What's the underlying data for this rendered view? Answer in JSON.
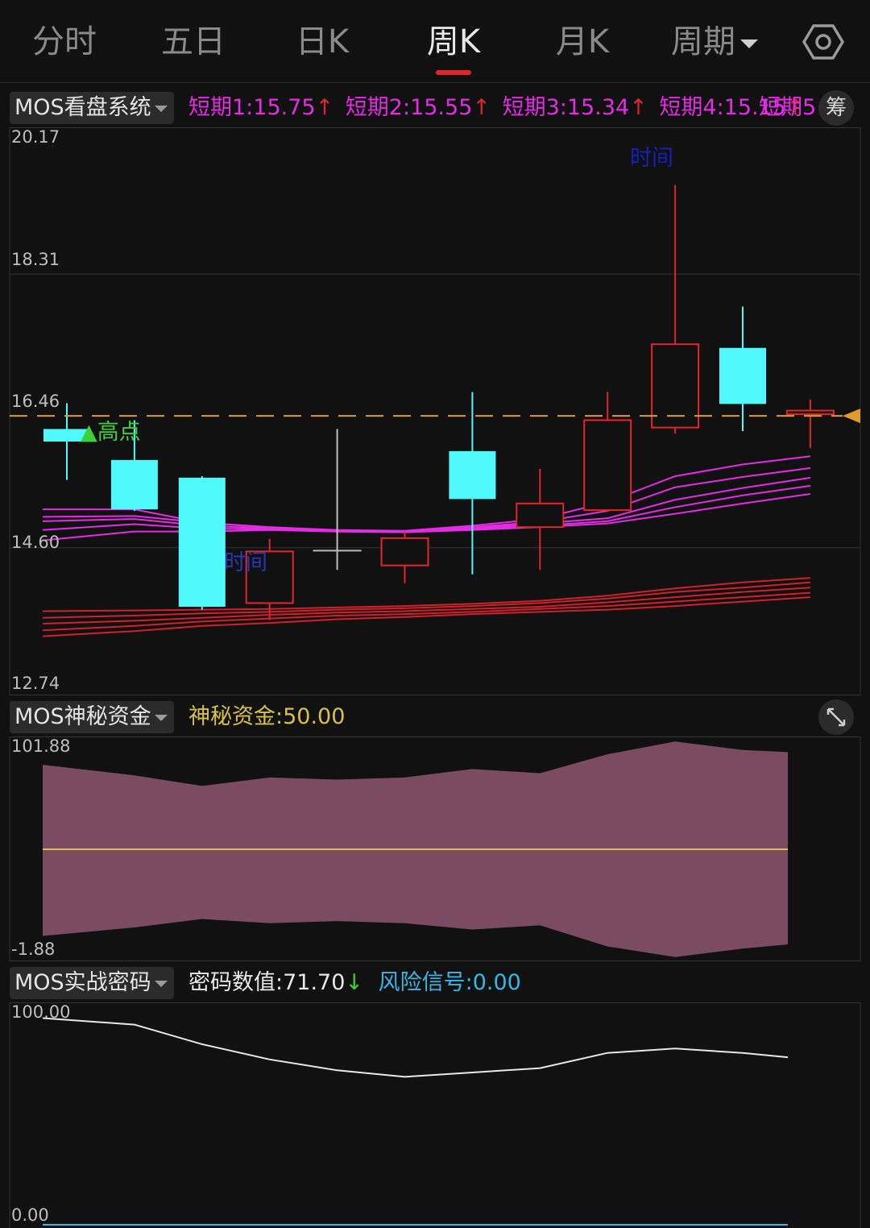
{
  "tabs": [
    "分时",
    "五日",
    "日K",
    "周K",
    "月K"
  ],
  "period_label": "周期",
  "colors": {
    "up": "#e0262a",
    "down": "#4ff9fb",
    "ma_short": "#e32ce4",
    "ma_long": "#d0202a",
    "price_line": "#e19a2c",
    "fund_fill": "#7b4c61",
    "fund_mid": "#d8c14a",
    "code_line": "#e8e8e8"
  },
  "main": {
    "indicator": "MOS看盘系统",
    "legend": [
      {
        "label": "短期1:",
        "value": "15.75",
        "arrow": "↑"
      },
      {
        "label": "短期2:",
        "value": "15.55",
        "arrow": "↑"
      },
      {
        "label": "短期3:",
        "value": "15.34",
        "arrow": "↑"
      },
      {
        "label": "短期4:",
        "value": "15.15",
        "arrow": "↑"
      },
      {
        "label": "短期5",
        "value": "",
        "arrow": ""
      }
    ],
    "chip_label": "筹",
    "y_ticks": [
      "20.17",
      "18.31",
      "16.46",
      "14.60",
      "12.74"
    ],
    "annotation_high": "▲高点",
    "annotation_time": "时间",
    "annotation_low": "时间",
    "candles": [
      {
        "o": 16.21,
        "c": 16.04,
        "h": 16.56,
        "l": 15.52,
        "up": false
      },
      {
        "o": 15.79,
        "c": 15.12,
        "h": 16.33,
        "l": 15.1,
        "up": false
      },
      {
        "o": 15.55,
        "c": 13.8,
        "h": 15.57,
        "l": 13.76,
        "up": false
      },
      {
        "o": 13.85,
        "c": 14.55,
        "h": 14.72,
        "l": 13.62,
        "up": true
      },
      {
        "o": 14.56,
        "c": 14.56,
        "h": 16.21,
        "l": 14.3,
        "up": true
      },
      {
        "o": 14.36,
        "c": 14.73,
        "h": 14.82,
        "l": 14.12,
        "up": true
      },
      {
        "o": 15.91,
        "c": 15.26,
        "h": 16.71,
        "l": 14.24,
        "up": false
      },
      {
        "o": 14.88,
        "c": 15.2,
        "h": 15.67,
        "l": 14.3,
        "up": true
      },
      {
        "o": 15.11,
        "c": 16.33,
        "h": 16.71,
        "l": 15.11,
        "up": true
      },
      {
        "o": 16.23,
        "c": 17.36,
        "h": 19.52,
        "l": 16.15,
        "up": true
      },
      {
        "o": 17.31,
        "c": 16.55,
        "h": 17.87,
        "l": 16.18,
        "up": false
      },
      {
        "o": 16.46,
        "c": 16.41,
        "h": 16.61,
        "l": 15.95,
        "up": true
      }
    ],
    "ma_short": [
      [
        15.12,
        15.12,
        14.94,
        14.88,
        14.84,
        14.83,
        14.9,
        14.99,
        15.22,
        15.57,
        15.73,
        15.84
      ],
      [
        15.02,
        15.03,
        14.94,
        14.87,
        14.84,
        14.82,
        14.88,
        14.95,
        15.1,
        15.42,
        15.56,
        15.68
      ],
      [
        14.96,
        14.99,
        14.9,
        14.86,
        14.83,
        14.81,
        14.86,
        14.93,
        15.0,
        15.25,
        15.41,
        15.55
      ],
      [
        14.84,
        14.92,
        14.86,
        14.85,
        14.82,
        14.81,
        14.85,
        14.9,
        14.96,
        15.15,
        15.31,
        15.44
      ],
      [
        14.7,
        14.82,
        14.82,
        14.84,
        14.82,
        14.81,
        14.84,
        14.88,
        14.93,
        15.06,
        15.2,
        15.33
      ]
    ],
    "ma_long": [
      [
        13.74,
        13.75,
        13.76,
        13.77,
        13.79,
        13.81,
        13.84,
        13.88,
        13.95,
        14.05,
        14.13,
        14.19
      ],
      [
        13.65,
        13.68,
        13.71,
        13.73,
        13.76,
        13.78,
        13.81,
        13.85,
        13.91,
        14.0,
        14.06,
        14.13
      ],
      [
        13.57,
        13.61,
        13.65,
        13.69,
        13.72,
        13.74,
        13.77,
        13.8,
        13.86,
        13.93,
        14.0,
        14.06
      ],
      [
        13.48,
        13.54,
        13.6,
        13.64,
        13.68,
        13.7,
        13.73,
        13.77,
        13.81,
        13.87,
        13.93,
        13.99
      ],
      [
        13.4,
        13.47,
        13.54,
        13.58,
        13.63,
        13.66,
        13.7,
        13.73,
        13.76,
        13.81,
        13.87,
        13.93
      ]
    ],
    "price_ref": 16.41,
    "y_range": [
      12.74,
      20.17
    ]
  },
  "fund": {
    "indicator": "MOS神秘资金",
    "label": "神秘资金:",
    "value": "50.00",
    "y_ticks": [
      "101.88",
      "-1.88"
    ],
    "upper": [
      90,
      85,
      80,
      84,
      83,
      84,
      88,
      86,
      95,
      101,
      97,
      96
    ],
    "lower": [
      9,
      13,
      17,
      15,
      16,
      15,
      12,
      14,
      4,
      -1,
      3,
      5
    ],
    "mid": 50,
    "y_range": [
      -1.88,
      101.88
    ]
  },
  "code": {
    "indicator": "MOS实战密码",
    "label": "密码数值:",
    "value": "71.70",
    "arrow": "↓",
    "risk_label": "风险信号:",
    "risk_value": "0.00",
    "y_ticks": [
      "100.00",
      "0.00"
    ],
    "line": [
      95,
      92,
      83,
      76,
      71,
      68,
      70,
      72,
      79,
      81,
      79,
      77
    ],
    "y_range": [
      0,
      100
    ]
  }
}
